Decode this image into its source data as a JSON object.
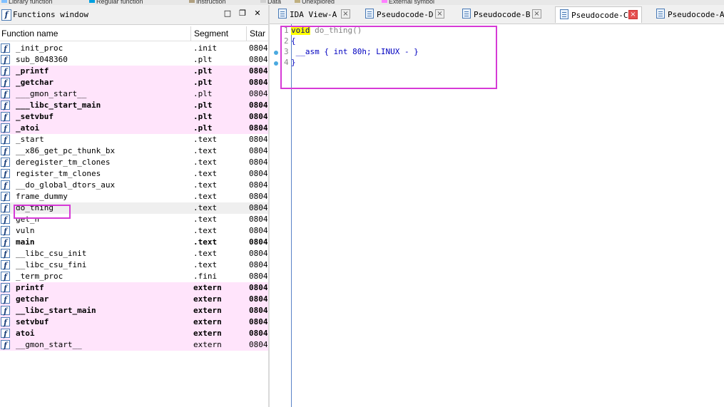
{
  "legend": [
    {
      "label": "Library function",
      "color": "#80c0ff"
    },
    {
      "label": "Regular function",
      "color": "#00a0e0"
    },
    {
      "label": "Instruction",
      "color": "#b0a080"
    },
    {
      "label": "Data",
      "color": "#d0d0d0"
    },
    {
      "label": "Unexplored",
      "color": "#c0b080"
    },
    {
      "label": "External symbol",
      "color": "#ff80ff"
    }
  ],
  "functions_window": {
    "title": "Functions window",
    "columns": {
      "name": "Function name",
      "segment": "Segment",
      "start": "Star"
    },
    "rows": [
      {
        "name": "_init_proc",
        "segment": ".init",
        "start": "0804",
        "style": "normal"
      },
      {
        "name": "sub_8048360",
        "segment": ".plt",
        "start": "0804",
        "style": "normal"
      },
      {
        "name": "_printf",
        "segment": ".plt",
        "start": "0804",
        "style": "pink-bold"
      },
      {
        "name": "_getchar",
        "segment": ".plt",
        "start": "0804",
        "style": "pink-bold"
      },
      {
        "name": "___gmon_start__",
        "segment": ".plt",
        "start": "0804",
        "style": "pink"
      },
      {
        "name": "___libc_start_main",
        "segment": ".plt",
        "start": "0804",
        "style": "pink-bold"
      },
      {
        "name": "_setvbuf",
        "segment": ".plt",
        "start": "0804",
        "style": "pink-bold"
      },
      {
        "name": "_atoi",
        "segment": ".plt",
        "start": "0804",
        "style": "pink-bold"
      },
      {
        "name": "_start",
        "segment": ".text",
        "start": "0804",
        "style": "normal"
      },
      {
        "name": "__x86_get_pc_thunk_bx",
        "segment": ".text",
        "start": "0804",
        "style": "normal"
      },
      {
        "name": "deregister_tm_clones",
        "segment": ".text",
        "start": "0804",
        "style": "normal"
      },
      {
        "name": "register_tm_clones",
        "segment": ".text",
        "start": "0804",
        "style": "normal"
      },
      {
        "name": "__do_global_dtors_aux",
        "segment": ".text",
        "start": "0804",
        "style": "normal"
      },
      {
        "name": "frame_dummy",
        "segment": ".text",
        "start": "0804",
        "style": "normal"
      },
      {
        "name": "do_thing",
        "segment": ".text",
        "start": "0804",
        "style": "selected"
      },
      {
        "name": "get_n",
        "segment": ".text",
        "start": "0804",
        "style": "normal"
      },
      {
        "name": "vuln",
        "segment": ".text",
        "start": "0804",
        "style": "normal"
      },
      {
        "name": "main",
        "segment": ".text",
        "start": "0804",
        "style": "bold"
      },
      {
        "name": "__libc_csu_init",
        "segment": ".text",
        "start": "0804",
        "style": "normal"
      },
      {
        "name": "__libc_csu_fini",
        "segment": ".text",
        "start": "0804",
        "style": "normal"
      },
      {
        "name": "_term_proc",
        "segment": ".fini",
        "start": "0804",
        "style": "normal"
      },
      {
        "name": "printf",
        "segment": "extern",
        "start": "0804",
        "style": "pink-bold"
      },
      {
        "name": "getchar",
        "segment": "extern",
        "start": "0804",
        "style": "pink-bold"
      },
      {
        "name": "__libc_start_main",
        "segment": "extern",
        "start": "0804",
        "style": "pink-bold"
      },
      {
        "name": "setvbuf",
        "segment": "extern",
        "start": "0804",
        "style": "pink-bold"
      },
      {
        "name": "atoi",
        "segment": "extern",
        "start": "0804",
        "style": "pink-bold"
      },
      {
        "name": "__gmon_start__",
        "segment": "extern",
        "start": "0804",
        "style": "pink"
      }
    ]
  },
  "tabs": [
    {
      "label": "IDA View-A",
      "active": false
    },
    {
      "label": "Pseudocode-D",
      "active": false
    },
    {
      "label": "Pseudocode-B",
      "active": false
    },
    {
      "label": "Pseudocode-C",
      "active": true
    },
    {
      "label": "Pseudocode-A",
      "active": false
    }
  ],
  "pseudocode": {
    "lines": [
      {
        "num": "1",
        "keyword": "void",
        "rest": " do_thing()",
        "breakpoint": false
      },
      {
        "num": "2",
        "keyword": "",
        "rest": "{",
        "breakpoint": false
      },
      {
        "num": "3",
        "keyword": "",
        "rest": "  __asm { int     80h; LINUX - }",
        "breakpoint": true
      },
      {
        "num": "4",
        "keyword": "",
        "rest": "}",
        "breakpoint": true
      }
    ]
  },
  "colors": {
    "highlight": "#d63ad6",
    "pink_row": "#ffe4fb",
    "keyword_bg": "#ffff00"
  }
}
